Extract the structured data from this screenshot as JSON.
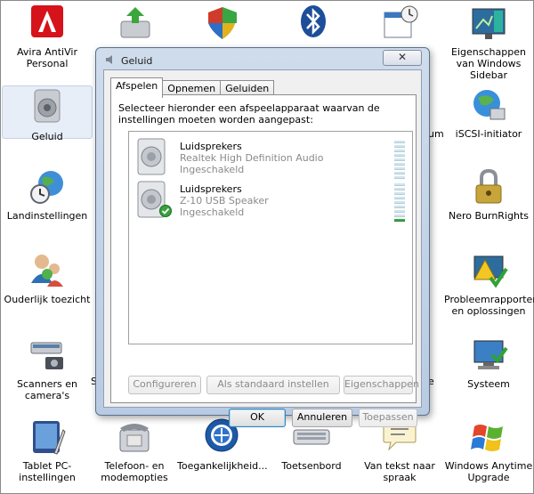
{
  "desktop": {
    "items": [
      {
        "label": "Avira AntiVir Personal"
      },
      {
        "label": "Geluid"
      },
      {
        "label": "Landinstellingen"
      },
      {
        "label": "Ouderlijk toezicht"
      },
      {
        "label": "Scanners en camera's"
      },
      {
        "label": "Tablet PC-instellingen"
      },
      {
        "label": "Telefoon- en modemopties"
      },
      {
        "label": "Toegankelijkheid..."
      },
      {
        "label": "Toetsenbord"
      },
      {
        "label": "Van tekst naar spraak"
      },
      {
        "label": "Windows Anytime Upgrade"
      },
      {
        "label": "Systeem"
      },
      {
        "label": "Probleemrapporten en oplossingen"
      },
      {
        "label": "Nero BurnRights"
      },
      {
        "label": "iSCSI-initiator"
      },
      {
        "label": "Eigenschappen van Windows Sidebar"
      }
    ],
    "partial": {
      "um": "um",
      "s": "S",
      "e": "e"
    }
  },
  "dialog": {
    "title": "Geluid",
    "close": "✕",
    "tabs": [
      {
        "label": "Afspelen"
      },
      {
        "label": "Opnemen"
      },
      {
        "label": "Geluiden"
      }
    ],
    "instruction": "Selecteer hieronder een afspeelapparaat waarvan de instellingen moeten worden aangepast:",
    "devices": [
      {
        "name": "Luidsprekers",
        "driver": "Realtek High Definition Audio",
        "status": "Ingeschakeld",
        "default": false,
        "level": 0
      },
      {
        "name": "Luidsprekers",
        "driver": "Z-10 USB Speaker",
        "status": "Ingeschakeld",
        "default": true,
        "level": 1
      }
    ],
    "buttons": {
      "configure": "Configureren",
      "set_default": "Als standaard instellen",
      "properties": "Eigenschappen",
      "ok": "OK",
      "cancel": "Annuleren",
      "apply": "Toepassen"
    }
  }
}
